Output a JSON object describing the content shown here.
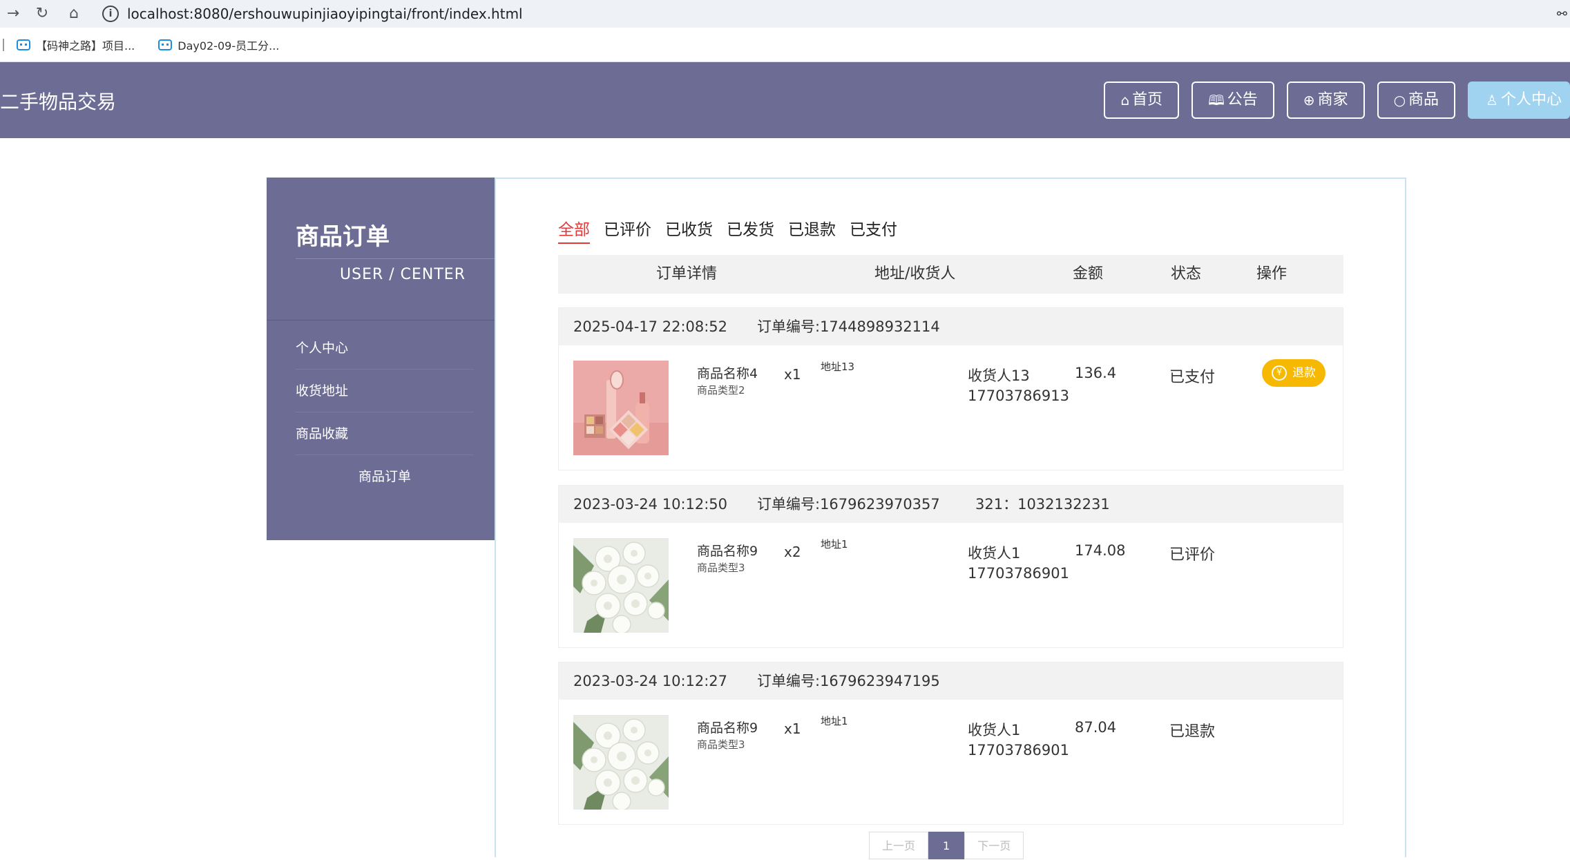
{
  "browser": {
    "url": "localhost:8080/ershouwupinjiaoyipingtai/front/index.html",
    "bookmarks": [
      "【码神之路】项目...",
      "Day02-09-员工分..."
    ]
  },
  "header": {
    "brand": "二手物品交易",
    "nav": [
      {
        "icon": "home-icon",
        "label": "首页"
      },
      {
        "icon": "book-icon",
        "label": "公告"
      },
      {
        "icon": "globe-icon",
        "label": "商家"
      },
      {
        "icon": "circle-icon",
        "label": "商品"
      },
      {
        "icon": "user-icon",
        "label": "个人中心"
      }
    ]
  },
  "sidebar": {
    "title": "商品订单",
    "subtitle": "USER / CENTER",
    "items": [
      "个人中心",
      "收货地址",
      "商品收藏",
      "商品订单"
    ]
  },
  "tabs": [
    "全部",
    "已评价",
    "已收货",
    "已发货",
    "已退款",
    "已支付"
  ],
  "table_header": {
    "detail": "订单详情",
    "address": "地址/收货人",
    "amount": "金额",
    "status": "状态",
    "action": "操作"
  },
  "orders": [
    {
      "time": "2025-04-17 22:08:52",
      "order_no": "订单编号:1744898932114",
      "extra": "",
      "product_name": "商品名称4",
      "product_type": "商品类型2",
      "qty": "x1",
      "address": "地址13",
      "receiver": "收货人13",
      "phone": "17703786913",
      "amount": "136.4",
      "status": "已支付",
      "action": "退款"
    },
    {
      "time": "2023-03-24 10:12:50",
      "order_no": "订单编号:1679623970357",
      "extra": "321：1032132231",
      "product_name": "商品名称9",
      "product_type": "商品类型3",
      "qty": "x2",
      "address": "地址1",
      "receiver": "收货人1",
      "phone": "17703786901",
      "amount": "174.08",
      "status": "已评价",
      "action": ""
    },
    {
      "time": "2023-03-24 10:12:27",
      "order_no": "订单编号:1679623947195",
      "extra": "",
      "product_name": "商品名称9",
      "product_type": "商品类型3",
      "qty": "x1",
      "address": "地址1",
      "receiver": "收货人1",
      "phone": "17703786901",
      "amount": "87.04",
      "status": "已退款",
      "action": ""
    }
  ],
  "pagination": {
    "prev": "上一页",
    "current": "1",
    "next": "下一页"
  },
  "colors": {
    "theme": "#6d6c94",
    "active_nav": "#9fd3ef",
    "tab_active": "#e23a3a",
    "refund_button": "#f6b800"
  }
}
